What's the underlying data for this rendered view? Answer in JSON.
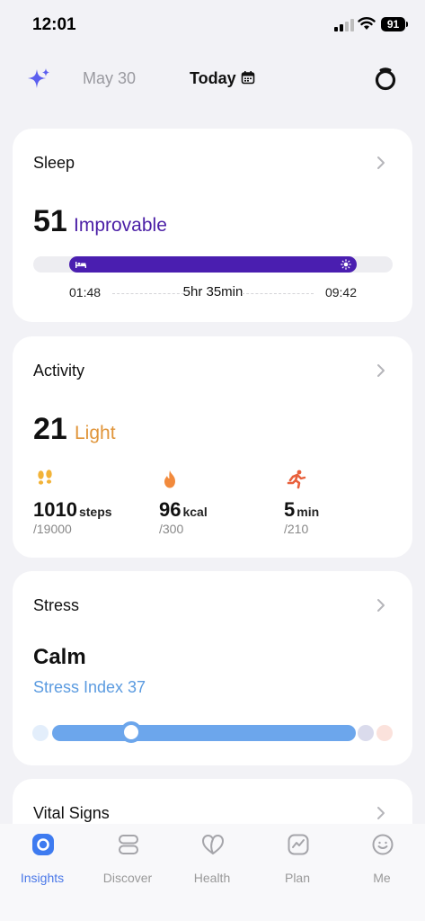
{
  "status_bar": {
    "time": "12:01",
    "battery": "91"
  },
  "top_nav": {
    "prev_date": "May 30",
    "current_date": "Today"
  },
  "sleep": {
    "title": "Sleep",
    "score": "51",
    "rating": "Improvable",
    "start_time": "01:48",
    "duration": "5hr 35min",
    "end_time": "09:42",
    "accent_color": "#4A1EB0"
  },
  "activity": {
    "title": "Activity",
    "score": "21",
    "rating": "Light",
    "rating_color": "#E0953A",
    "metrics": [
      {
        "icon": "footsteps-icon",
        "value": "1010",
        "unit": "steps",
        "goal": "/19000"
      },
      {
        "icon": "flame-icon",
        "value": "96",
        "unit": "kcal",
        "goal": "/300"
      },
      {
        "icon": "running-person-icon",
        "value": "5",
        "unit": "min",
        "goal": "/210"
      }
    ]
  },
  "stress": {
    "title": "Stress",
    "state": "Calm",
    "index_label": "Stress Index 37",
    "index_value": 37,
    "index_color": "#5B9BE0"
  },
  "vital_signs": {
    "title": "Vital Signs"
  },
  "tab_bar": {
    "tabs": [
      {
        "label": "Insights",
        "icon": "insights-icon",
        "active": true
      },
      {
        "label": "Discover",
        "icon": "discover-icon",
        "active": false
      },
      {
        "label": "Health",
        "icon": "health-icon",
        "active": false
      },
      {
        "label": "Plan",
        "icon": "plan-icon",
        "active": false
      },
      {
        "label": "Me",
        "icon": "me-icon",
        "active": false
      }
    ]
  }
}
